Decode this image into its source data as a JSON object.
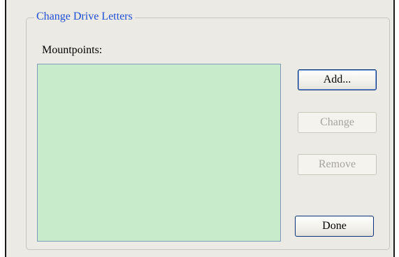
{
  "group": {
    "title": "Change Drive Letters"
  },
  "mountpoints": {
    "label": "Mountpoints:",
    "items": []
  },
  "buttons": {
    "add": {
      "label": "Add...",
      "enabled": true
    },
    "change": {
      "label": "Change",
      "enabled": false
    },
    "remove": {
      "label": "Remove",
      "enabled": false
    },
    "done": {
      "label": "Done",
      "enabled": true
    }
  },
  "colors": {
    "group_title": "#1f4fd6",
    "list_background": "#c8ebcb",
    "panel_background": "#eceae4"
  }
}
